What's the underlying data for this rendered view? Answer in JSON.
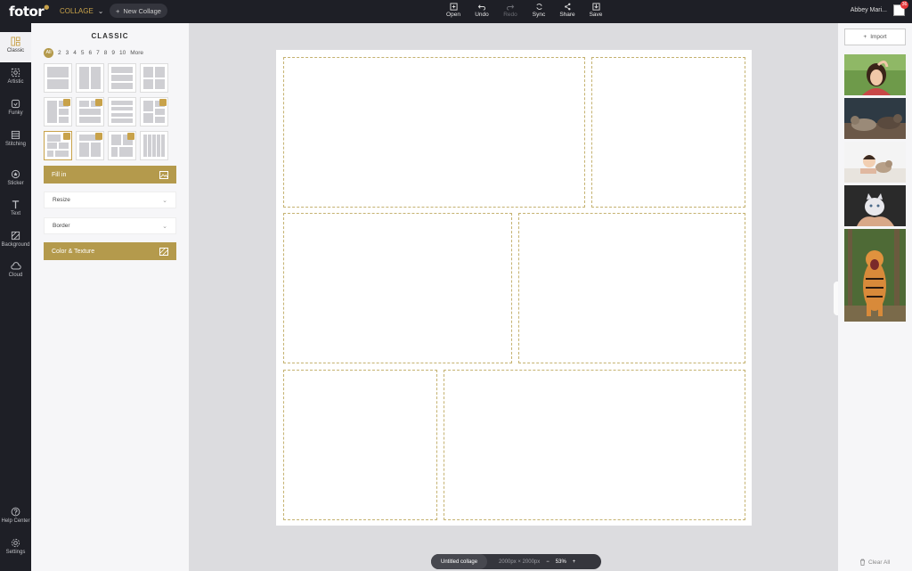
{
  "topbar": {
    "logo": "fotor",
    "mode_label": "COLLAGE",
    "new_collage_label": "New Collage",
    "tools": [
      {
        "label": "Open",
        "icon": "open-icon",
        "enabled": true
      },
      {
        "label": "Undo",
        "icon": "undo-icon",
        "enabled": true
      },
      {
        "label": "Redo",
        "icon": "redo-icon",
        "enabled": false
      },
      {
        "label": "Sync",
        "icon": "sync-icon",
        "enabled": true
      },
      {
        "label": "Share",
        "icon": "share-icon",
        "enabled": true
      },
      {
        "label": "Save",
        "icon": "save-icon",
        "enabled": true
      }
    ],
    "user_name": "Abbey Mari...",
    "notification_count": "36"
  },
  "rail": {
    "items": [
      {
        "label": "Classic",
        "icon": "classic-layout-icon"
      },
      {
        "label": "Artistic",
        "icon": "artistic-icon"
      },
      {
        "label": "Funky",
        "icon": "funky-icon"
      },
      {
        "label": "Stitching",
        "icon": "stitching-icon"
      },
      {
        "label": "Sticker",
        "icon": "sticker-icon"
      },
      {
        "label": "Text",
        "icon": "text-icon"
      },
      {
        "label": "Background",
        "icon": "background-icon"
      },
      {
        "label": "Cloud",
        "icon": "cloud-icon"
      }
    ],
    "bottom_items": [
      {
        "label": "Help Center",
        "icon": "help-icon"
      },
      {
        "label": "Settings",
        "icon": "settings-icon"
      }
    ]
  },
  "panel": {
    "title": "CLASSIC",
    "filters": [
      "All",
      "2",
      "3",
      "4",
      "5",
      "6",
      "7",
      "8",
      "9",
      "10",
      "More"
    ],
    "fill_in_label": "Fill in",
    "resize_label": "Resize",
    "border_label": "Border",
    "color_texture_label": "Color & Texture"
  },
  "right_panel": {
    "import_label": "Import",
    "thumbnails": [
      "woman-photo",
      "cats-photo",
      "child-with-cat-photo",
      "kitten-in-hands-photo",
      "tiger-photo"
    ],
    "clear_all_label": "Clear All"
  },
  "status": {
    "doc_name": "Untitled collage",
    "dimensions": "2000px × 2000px",
    "zoom": "53%"
  },
  "colors": {
    "accent": "#b49a4c",
    "dark": "#1e1f26"
  }
}
